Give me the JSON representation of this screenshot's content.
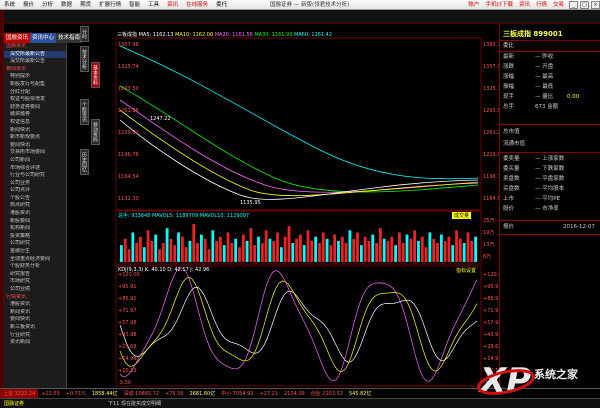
{
  "menubar": {
    "items": [
      "系统",
      "报价",
      "分析",
      "数据",
      "期货",
      "扩展行情",
      "智能",
      "工具",
      "资讯",
      "在线服务",
      "委托"
    ],
    "title": "国融证券 — 新版(领君技术分析)",
    "right_links": [
      "账户",
      "手机炒下载",
      "资讯",
      "行情",
      "交易",
      "行情"
    ]
  },
  "sidebar": {
    "tabs": [
      "国融资讯",
      "资讯中心",
      "技术指南"
    ],
    "items": [
      {
        "text": "国融资讯",
        "section": true
      },
      {
        "text": "深交所最新公告",
        "active": true
      },
      {
        "text": "深交所最新公告"
      },
      {
        "text": "要闻资讯",
        "section": true
      },
      {
        "text": "特别提示"
      },
      {
        "text": "新股发行与配售"
      },
      {
        "text": "分红分配"
      },
      {
        "text": "权证与股票增发"
      },
      {
        "text": "财务证券要闻"
      },
      {
        "text": "融资融券"
      },
      {
        "text": "权证信息"
      },
      {
        "text": "新闻快讯"
      },
      {
        "text": "新市新规要点"
      },
      {
        "text": "要闻快讯"
      },
      {
        "text": "交易所市场要闻"
      },
      {
        "text": "公司新闻"
      },
      {
        "text": "市场综合评述"
      },
      {
        "text": "行业与公司研究"
      },
      {
        "text": "公司业务"
      },
      {
        "text": "公司点评"
      },
      {
        "text": "个股公告"
      },
      {
        "text": "热点研究"
      },
      {
        "text": "港股资讯"
      },
      {
        "text": "新股要闻"
      },
      {
        "text": "机构新闻"
      },
      {
        "text": "投资策略"
      },
      {
        "text": "公司研究"
      },
      {
        "text": "金融衍生"
      },
      {
        "text": "全球重点经济要闻"
      },
      {
        "text": "个股财务分析"
      },
      {
        "text": "研究报告"
      },
      {
        "text": "市场研究"
      },
      {
        "text": "公司业绩"
      },
      {
        "text": "行情资讯",
        "section": true
      },
      {
        "text": "港股资讯"
      },
      {
        "text": "新闻资讯"
      },
      {
        "text": "要闻快讯"
      },
      {
        "text": "新三板资讯"
      },
      {
        "text": "行业研究"
      },
      {
        "text": "资讯新闻"
      }
    ]
  },
  "vtabs": [
    "分时",
    "技术分析",
    "基本资料",
    "个股资讯",
    "移动筹码",
    "历史回忆"
  ],
  "chart_header": {
    "stock": "三板成指",
    "items": [
      {
        "text": "MA5: 1162.13",
        "color": "#ffffff"
      },
      {
        "text": "MA10: 1162.00",
        "color": "#ffff00"
      },
      {
        "text": "MA20: 1161.58",
        "color": "#ff66ff"
      },
      {
        "text": "MA30: 1161.93",
        "color": "#00ff00"
      },
      {
        "text": "MA60: 1161.42",
        "color": "#00ffff"
      }
    ]
  },
  "main_chart": {
    "y_ticks": [
      "1357.98",
      "1325.74",
      "1293.50",
      "1261.26",
      "1229.02",
      "1196.78",
      "1164.54",
      "1132.30"
    ],
    "high_label": "1247.22",
    "low_label": "1135.95",
    "right_ticks": [
      "1383.71",
      "1357.98",
      "1325.74",
      "1293.50",
      "1261.26",
      "1229.02",
      "1196.78",
      "1164.54"
    ]
  },
  "volume_chart": {
    "label": "总手: 913648  MAVOL5: 1189709  MAVOL10: 1129097",
    "btn": "成交量",
    "y_ticks": [
      "25万",
      "19万",
      "13万",
      "6万"
    ],
    "bars": [
      8,
      11,
      6,
      14,
      9,
      12,
      7,
      15,
      10,
      13,
      6,
      9,
      16,
      11,
      8,
      14,
      12,
      7,
      10,
      18,
      9,
      13,
      11,
      6,
      15,
      10,
      12,
      8,
      14,
      9,
      11,
      7,
      13,
      10,
      16,
      8,
      12,
      9,
      15,
      11,
      10,
      14,
      7,
      12,
      17,
      9,
      11,
      13,
      8,
      15,
      10,
      12,
      9,
      14,
      11,
      8,
      13,
      10,
      12,
      9,
      15,
      11,
      14,
      8,
      12,
      10,
      13,
      9,
      16,
      11,
      10,
      12,
      8,
      14,
      9,
      13,
      11,
      15,
      10,
      12,
      7,
      14,
      11,
      9,
      13,
      10,
      12,
      8,
      15,
      11,
      9,
      14,
      10,
      12
    ]
  },
  "kdj_chart": {
    "label": "KDJ(9,3,3)  K: 40.10  D: 42.17  J: 42.96",
    "btn": "指标设置",
    "y_ticks": [
      "+120.00",
      "+95.91",
      "+85.91",
      "+71.97",
      "+57.98",
      "+43.98",
      "+29.68",
      "+14.98",
      "+10.19",
      "-3.30"
    ]
  },
  "right_panel": {
    "title": "三板成指 899001",
    "rows": [
      {
        "lab": "委比",
        "val": "",
        "v2": ""
      },
      {
        "lab": "最新",
        "val": "— 昨收",
        "v2": ""
      },
      {
        "lab": "涨跌",
        "val": "— 开盘",
        "v2": ""
      },
      {
        "lab": "涨幅",
        "val": "— 最高",
        "v2": ""
      },
      {
        "lab": "振幅",
        "val": "— 最低",
        "v2": ""
      },
      {
        "lab": "现手",
        "val": "— 量比",
        "v2": "0.00"
      },
      {
        "lab": "总手",
        "val": "673 金额",
        "v2": ""
      }
    ],
    "mid": [
      "总市值",
      "流通市值"
    ],
    "rows2": [
      {
        "lab": "委卖量",
        "val": "— 上涨家数"
      },
      {
        "lab": "委买量",
        "val": "— 下跌家数"
      },
      {
        "lab": "卖盘数",
        "val": "— 平盘家数"
      },
      {
        "lab": "买盘数",
        "val": "— 平均股本"
      },
      {
        "lab": "上市",
        "val": "— 平均PE"
      },
      {
        "lab": "股价",
        "val": "— 市净率"
      }
    ],
    "footer": {
      "lab": "报价",
      "date": "2016-12-07"
    }
  },
  "statusbar": {
    "items": [
      {
        "text": "上证 3222.24",
        "color": "#ff5555"
      },
      {
        "text": "+22.59",
        "color": "#ff5555"
      },
      {
        "text": "+0.71%",
        "color": "#ff5555"
      },
      {
        "text": "1858.44亿",
        "color": "#ffff55"
      },
      {
        "text": "深成 10865.72",
        "color": "#ff5555"
      },
      {
        "text": "+75.36",
        "color": "#ff5555"
      },
      {
        "text": "2681.60亿",
        "color": "#ffff55"
      },
      {
        "text": "中小 7054.92",
        "color": "#ff5555"
      },
      {
        "text": "+27.21",
        "color": "#ff5555"
      },
      {
        "text": "2134.39",
        "color": "#ff5555"
      },
      {
        "text": "创业 2203.52",
        "color": "#ff5555"
      },
      {
        "text": "545.82亿",
        "color": "#ffff55"
      }
    ]
  },
  "bottombar": {
    "left": "国融证券",
    "right": "下11 现在能买成交明细"
  },
  "watermark": "系统之家"
}
